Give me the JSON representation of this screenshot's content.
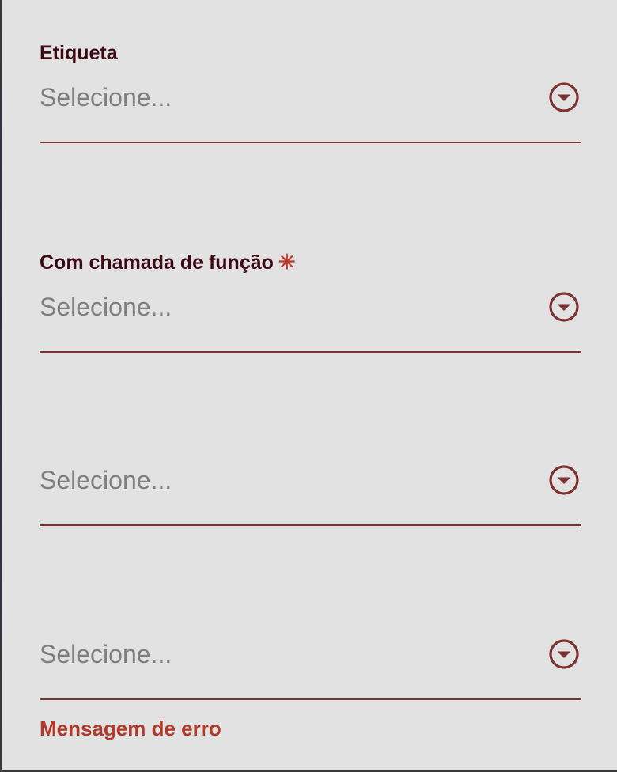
{
  "colors": {
    "background": "#e2e2e2",
    "label": "#3b0a16",
    "placeholder": "#7f7f7f",
    "accent": "#7a3232",
    "required": "#c0392b",
    "error": "#b33a2a"
  },
  "fields": [
    {
      "label": "Etiqueta",
      "required": false,
      "placeholder": "Selecione...",
      "icon": "chevron-down-circle-icon"
    },
    {
      "label": "Com chamada de função",
      "required": true,
      "required_mark": "✳",
      "placeholder": "Selecione...",
      "icon": "chevron-down-circle-icon"
    },
    {
      "label": "",
      "required": false,
      "placeholder": "Selecione...",
      "icon": "chevron-down-circle-icon"
    },
    {
      "label": "",
      "required": false,
      "placeholder": "Selecione...",
      "icon": "chevron-down-circle-icon",
      "error": "Mensagem de erro"
    }
  ]
}
